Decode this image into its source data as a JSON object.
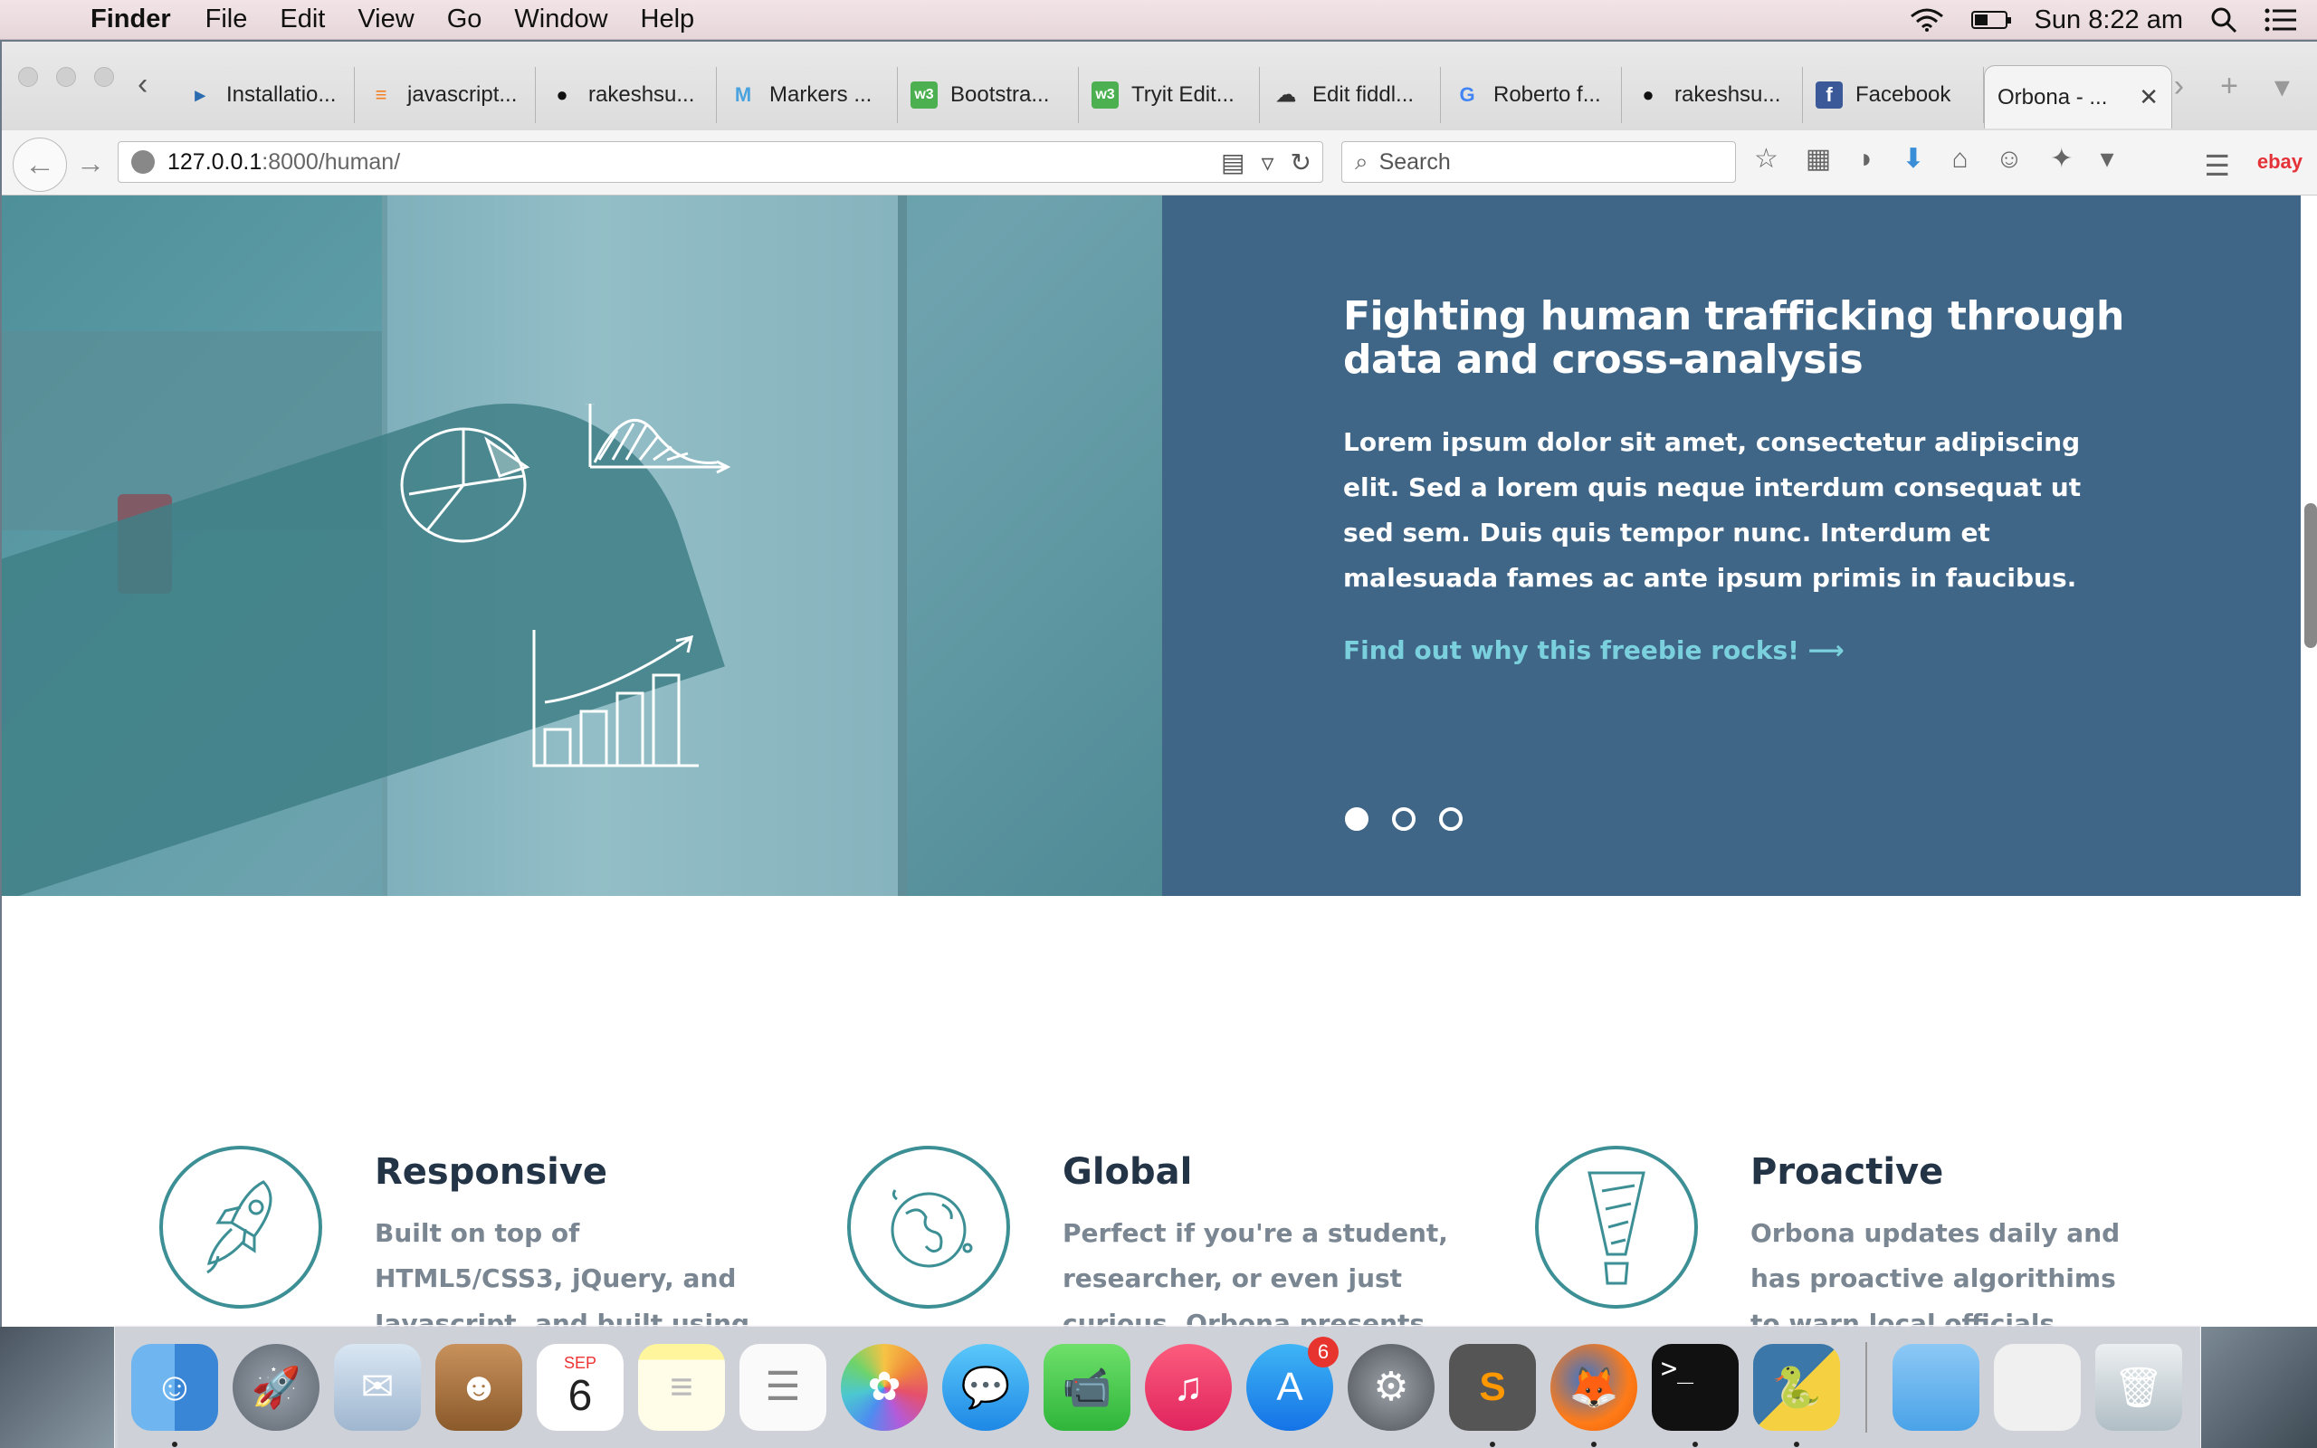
{
  "menubar": {
    "app_name": "Finder",
    "items": [
      "File",
      "Edit",
      "View",
      "Go",
      "Window",
      "Help"
    ],
    "clock": "Sun 8:22 am"
  },
  "browser": {
    "tabs": [
      {
        "label": "Installatio...",
        "icon": "bookmark-icon",
        "color": "#2b6cb0"
      },
      {
        "label": "javascript...",
        "icon": "stackoverflow-icon",
        "color": "#f48024"
      },
      {
        "label": "rakeshsu...",
        "icon": "github-icon",
        "color": "#111111"
      },
      {
        "label": "Markers ...",
        "icon": "m-icon",
        "color": "#4aa3df"
      },
      {
        "label": "Bootstra...",
        "icon": "w3-icon",
        "color": "#4caf50"
      },
      {
        "label": "Tryit Edit...",
        "icon": "w3-icon",
        "color": "#4caf50"
      },
      {
        "label": "Edit fiddl...",
        "icon": "jsfiddle-icon",
        "color": "#333333"
      },
      {
        "label": "Roberto f...",
        "icon": "google-icon",
        "color": "#4285f4"
      },
      {
        "label": "rakeshsu...",
        "icon": "github-icon",
        "color": "#111111"
      },
      {
        "label": "Facebook",
        "icon": "facebook-icon",
        "color": "#3b5998"
      }
    ],
    "active_tab": "Orbona - ...",
    "url_host": "127.0.0.1",
    "url_rest": ":8000/human/",
    "search_placeholder": "Search",
    "ebay": "ebay"
  },
  "hero": {
    "title": "Fighting human trafficking through data and cross-analysis",
    "body": "Lorem ipsum dolor sit amet, consectetur adipiscing elit. Sed a lorem quis neque interdum consequat ut sed sem. Duis quis tempor nunc. Interdum et malesuada fames ac ante ipsum primis in faucibus.",
    "link": "Find out why this freebie rocks! ⟶",
    "slide_count": 3,
    "active_slide": 1
  },
  "features": [
    {
      "title": "Responsive",
      "body": "Built on top of HTML5/CSS3, jQuery, and Javascript, and built using one of the world's most",
      "icon": "rocket-icon"
    },
    {
      "title": "Global",
      "body": "Perfect if you're a student, researcher, or even just curious. Orbona presents information and",
      "icon": "globe-icon"
    },
    {
      "title": "Proactive",
      "body": "Orbona updates daily and has proactive algorithims to warn local officials, citiznes, and NGOs of",
      "icon": "exclamation-icon"
    }
  ],
  "dock": {
    "calendar_month": "SEP",
    "calendar_day": "6",
    "appstore_badge": "6",
    "apps": [
      "Finder",
      "Launchpad",
      "Mail",
      "Contacts",
      "Calendar",
      "Notes",
      "Reminders",
      "Photos",
      "Messages",
      "FaceTime",
      "iTunes",
      "App Store",
      "System Preferences",
      "Sublime Text",
      "Firefox",
      "Terminal",
      "Python",
      "Folder",
      "Preview",
      "Trash"
    ]
  },
  "colors": {
    "hero_bg": "#3f6587",
    "accent_teal": "#3c8f94",
    "link": "#7ad1dd"
  }
}
